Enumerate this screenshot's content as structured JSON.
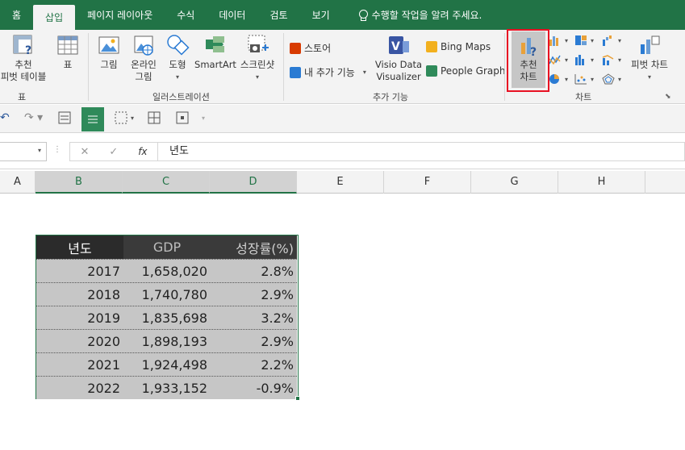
{
  "ribbon_tabs": [
    "홈",
    "삽입",
    "페이지 레이아웃",
    "수식",
    "데이터",
    "검토",
    "보기"
  ],
  "active_tab": "삽입",
  "tell_me": "수행할 작업을 알려 주세요.",
  "groups": {
    "tables": {
      "label": "표",
      "pivot_line1": "추천",
      "pivot_line2": "피벗 테이블",
      "table": "표"
    },
    "illustrations": {
      "label": "일러스트레이션",
      "picture": "그림",
      "online_line1": "온라인",
      "online_line2": "그림",
      "shapes": "도형",
      "smartart": "SmartArt",
      "screenshot": "스크린샷"
    },
    "addins": {
      "label": "추가 기능",
      "store": "스토어",
      "my_addins": "내 추가 기능",
      "visio_line1": "Visio Data",
      "visio_line2": "Visualizer",
      "bing": "Bing Maps",
      "people": "People Graph"
    },
    "charts": {
      "label": "차트",
      "recommended_line1": "추천",
      "recommended_line2": "차트",
      "pivot_chart": "피벗 차트"
    }
  },
  "formula_bar": {
    "fx": "fx",
    "value": "년도"
  },
  "columns": [
    "A",
    "B",
    "C",
    "D",
    "E",
    "F",
    "G",
    "H"
  ],
  "selected_columns": [
    "B",
    "C",
    "D"
  ],
  "table": {
    "headers": [
      "년도",
      "GDP",
      "성장률(%)"
    ],
    "rows": [
      [
        "2017",
        "1,658,020",
        "2.8%"
      ],
      [
        "2018",
        "1,740,780",
        "2.9%"
      ],
      [
        "2019",
        "1,835,698",
        "3.2%"
      ],
      [
        "2020",
        "1,898,193",
        "2.9%"
      ],
      [
        "2021",
        "1,924,498",
        "2.2%"
      ],
      [
        "2022",
        "1,933,152",
        "-0.9%"
      ]
    ]
  },
  "colors": {
    "accent": "#217346",
    "highlight": "#e81123",
    "table_header": "#3a3a3a",
    "table_body": "#c6c6c6"
  }
}
